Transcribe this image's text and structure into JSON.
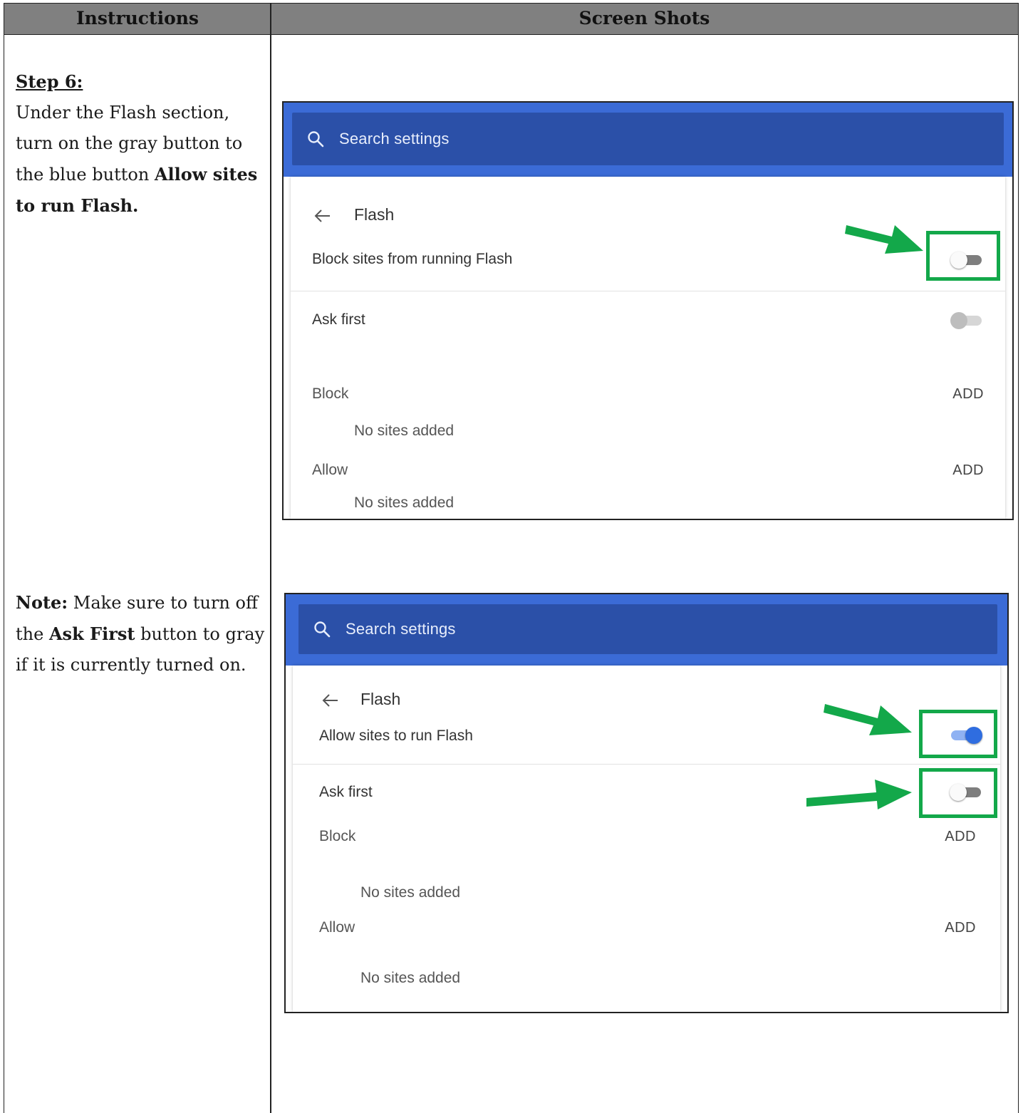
{
  "table": {
    "col_instructions": "Instructions",
    "col_screenshots": "Screen Shots"
  },
  "instructions": {
    "step_title": "Step 6:",
    "step_text_1": "Under the Flash section, turn on the gray button to the blue button ",
    "step_text_bold": "Allow sites to run Flash.",
    "note_label": "Note:",
    "note_text_1": " Make sure to turn off the ",
    "note_bold": "Ask First",
    "note_text_2": " button to gray if it is currently turned on."
  },
  "screenshot1": {
    "search_placeholder": "Search settings",
    "page_title": "Flash",
    "main_toggle_label": "Block sites from running Flash",
    "main_toggle_state": "off",
    "ask_first_label": "Ask first",
    "ask_first_state": "off-disabled",
    "block_label": "Block",
    "block_add": "ADD",
    "block_empty": "No sites added",
    "allow_label": "Allow",
    "allow_add": "ADD",
    "allow_empty": "No sites added"
  },
  "screenshot2": {
    "search_placeholder": "Search settings",
    "page_title": "Flash",
    "main_toggle_label": "Allow sites to run Flash",
    "main_toggle_state": "on",
    "ask_first_label": "Ask first",
    "ask_first_state": "off",
    "block_label": "Block",
    "block_add": "ADD",
    "block_empty": "No sites added",
    "allow_label": "Allow",
    "allow_add": "ADD",
    "allow_empty": "No sites added"
  },
  "colors": {
    "header_gray": "#808080",
    "settings_blue": "#3b6bd6",
    "search_bar_blue": "#2b50a8",
    "highlight_green": "#13a84a",
    "toggle_on_blue": "#2f6de0"
  },
  "icons": {
    "search": "search-icon",
    "back": "back-arrow-icon",
    "pointer": "green-arrow-icon"
  }
}
